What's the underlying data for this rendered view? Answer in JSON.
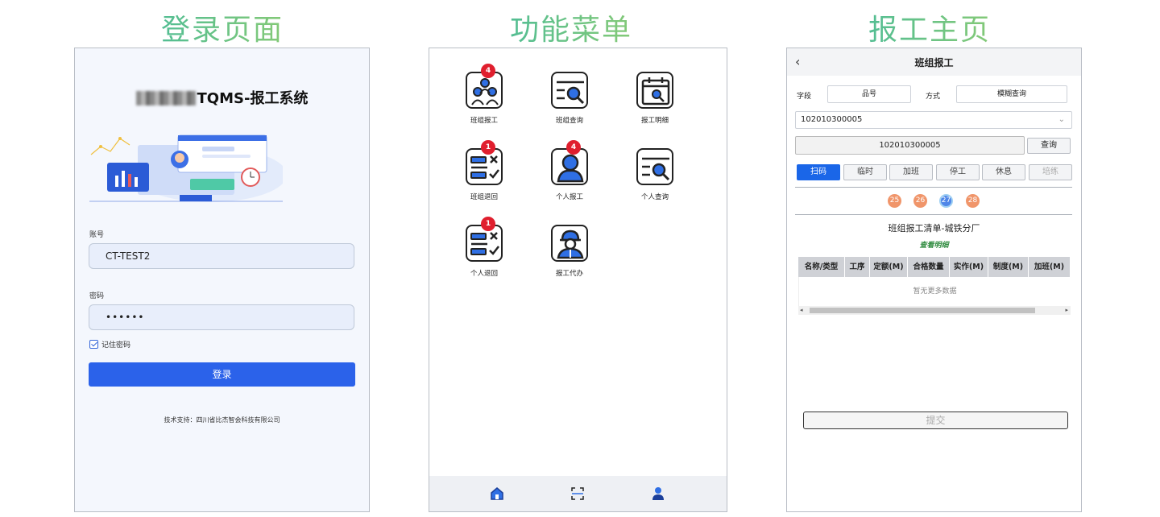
{
  "sections": {
    "login_heading": "登录页面",
    "menu_heading": "功能菜单",
    "report_heading": "报工主页"
  },
  "login": {
    "title": "TQMS-报工系统",
    "account_label": "账号",
    "account_value": "CT-TEST2",
    "password_label": "密码",
    "password_value": "••••••",
    "remember_label": "记住密码",
    "login_button": "登录",
    "support_text": "技术支持：四川省比杰智会科技有限公司"
  },
  "menu": {
    "items": [
      {
        "label": "班组报工",
        "badge": "4",
        "icon": "team-icon"
      },
      {
        "label": "班组查询",
        "badge": "",
        "icon": "list-search-icon"
      },
      {
        "label": "报工明细",
        "badge": "",
        "icon": "calendar-search-icon"
      },
      {
        "label": "班组退回",
        "badge": "1",
        "icon": "list-return-icon"
      },
      {
        "label": "个人报工",
        "badge": "4",
        "icon": "person-icon"
      },
      {
        "label": "个人查询",
        "badge": "",
        "icon": "list-search-icon"
      },
      {
        "label": "个人退回",
        "badge": "1",
        "icon": "list-return-icon"
      },
      {
        "label": "报工代办",
        "badge": "",
        "icon": "worker-icon"
      }
    ],
    "tabs": [
      "home-icon",
      "scan-icon",
      "user-icon"
    ]
  },
  "report": {
    "title": "班组报工",
    "field_label": "字段",
    "field_value": "品号",
    "mode_label": "方式",
    "mode_value": "模糊查询",
    "select_value": "102010300005",
    "input_value": "102010300005",
    "query_button": "查询",
    "segments": [
      "扫码",
      "临时",
      "加班",
      "停工",
      "休息",
      "培练"
    ],
    "days": [
      "25",
      "26",
      "27",
      "28"
    ],
    "list_title": "班组报工清单-城铁分厂",
    "view_detail": "查看明细",
    "columns": [
      "名称/类型",
      "工序",
      "定额(M)",
      "合格数量",
      "实作(M)",
      "制度(M)",
      "加班(M)"
    ],
    "empty_text": "暂无更多数据",
    "submit_button": "提交"
  },
  "colors": {
    "primary": "#2b62ea",
    "badge": "#e01f2e",
    "day": "#f0956a",
    "day_selected": "#4f86e8",
    "detail_link": "#2e8b3e"
  }
}
